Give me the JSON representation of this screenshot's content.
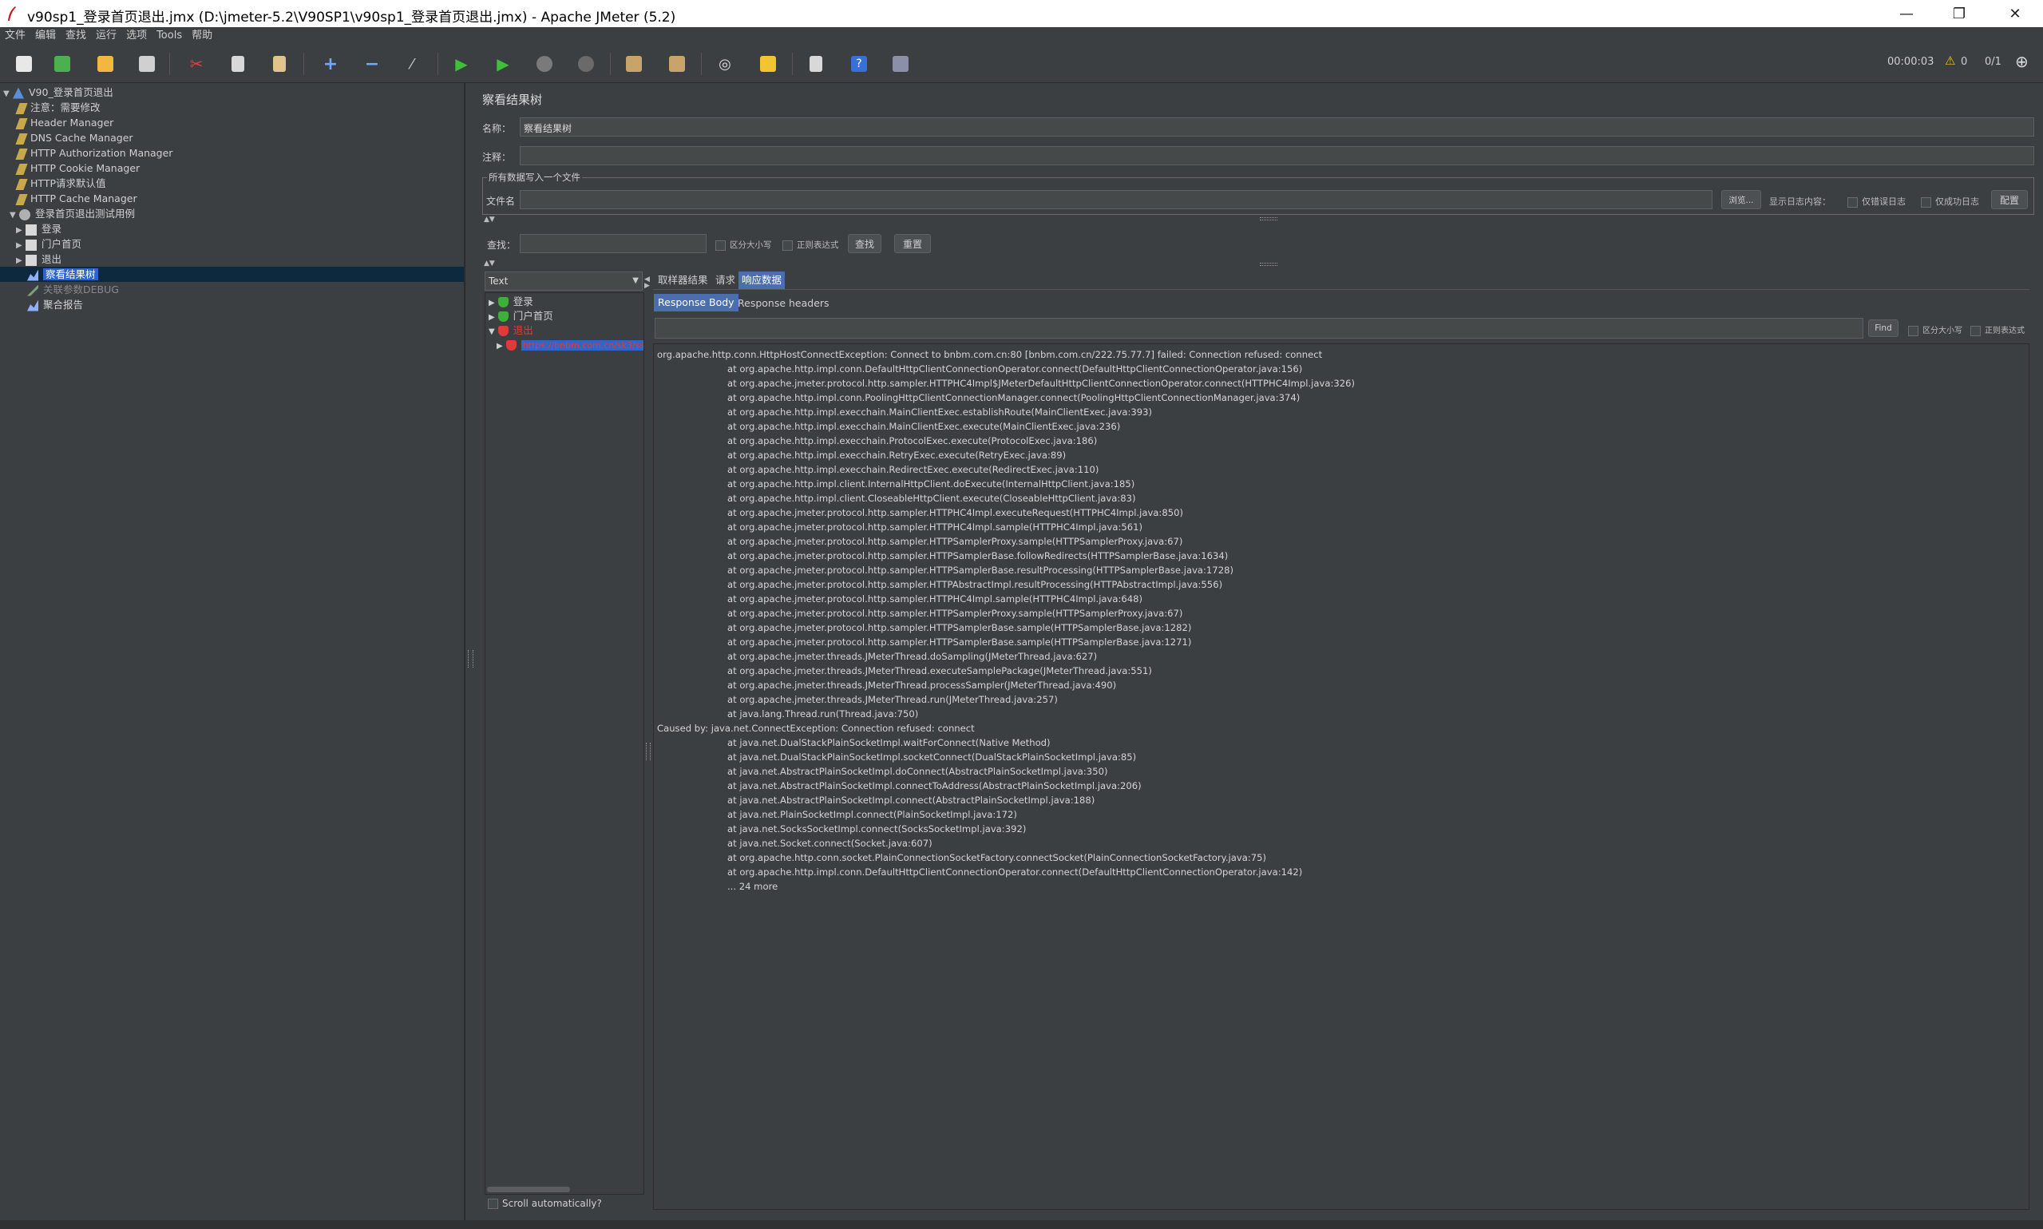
{
  "window": {
    "title": "v90sp1_登录首页退出.jmx (D:\\jmeter-5.2\\V90SP1\\v90sp1_登录首页退出.jmx) - Apache JMeter (5.2)",
    "minimize": "—",
    "maximize": "❐",
    "close": "✕"
  },
  "menu": [
    "文件",
    "编辑",
    "查找",
    "运行",
    "选项",
    "Tools",
    "帮助"
  ],
  "toolbar": {
    "elapsed": "00:00:03",
    "warnings": "0",
    "threads": "0/1"
  },
  "tree": {
    "items": [
      {
        "label": "V90_登录首页退出",
        "depth": 0,
        "expanded": true,
        "icon": "testplan-icon"
      },
      {
        "label": "注意：需要修改",
        "depth": 1,
        "icon": "config-icon"
      },
      {
        "label": "Header Manager",
        "depth": 1,
        "icon": "config-icon"
      },
      {
        "label": "DNS Cache Manager",
        "depth": 1,
        "icon": "config-icon"
      },
      {
        "label": "HTTP Authorization Manager",
        "depth": 1,
        "icon": "config-icon"
      },
      {
        "label": "HTTP Cookie Manager",
        "depth": 1,
        "icon": "config-icon"
      },
      {
        "label": "HTTP请求默认值",
        "depth": 1,
        "icon": "config-icon"
      },
      {
        "label": "HTTP Cache Manager",
        "depth": 1,
        "icon": "config-icon"
      },
      {
        "label": "登录首页退出测试用例",
        "depth": 1,
        "expanded": true,
        "icon": "threadgroup-icon"
      },
      {
        "label": "登录",
        "depth": 2,
        "collapsed": true,
        "icon": "controller-icon"
      },
      {
        "label": "门户首页",
        "depth": 2,
        "collapsed": true,
        "icon": "controller-icon"
      },
      {
        "label": "退出",
        "depth": 2,
        "collapsed": true,
        "icon": "controller-icon"
      },
      {
        "label": "察看结果树",
        "depth": 2,
        "selected": true,
        "icon": "listener-icon"
      },
      {
        "label": "关联参数DEBUG",
        "depth": 2,
        "disabled": true,
        "icon": "listener-icon"
      },
      {
        "label": "聚合报告",
        "depth": 2,
        "icon": "listener-icon"
      }
    ]
  },
  "panel": {
    "title": "察看结果树",
    "name_label": "名称：",
    "name_value": "察看结果树",
    "comment_label": "注释：",
    "comment_value": "",
    "file_group_label": "所有数据写入一个文件",
    "filename_label": "文件名",
    "filename_value": "",
    "browse_button": "浏览...",
    "log_display_label": "显示日志内容：",
    "errors_only_label": "仅错误日志",
    "success_only_label": "仅成功日志",
    "configure_button": "配置",
    "search_label": "查找：",
    "search_value": "",
    "case_sensitive_label": "区分大小写",
    "regex_label": "正则表达式",
    "find_button": "查找",
    "reset_button": "重置"
  },
  "renderer": {
    "selected": "Text"
  },
  "samples": [
    {
      "label": "登录",
      "status": "success",
      "expanded": false
    },
    {
      "label": "门户首页",
      "status": "success",
      "expanded": false
    },
    {
      "label": "退出",
      "status": "error",
      "expanded": true
    },
    {
      "label": "https://bnbm.com.cn/sk3/sso",
      "status": "error",
      "selected": true
    }
  ],
  "scroll_auto_label": "Scroll automatically?",
  "tabs": {
    "sampler_result": "取样器结果",
    "request": "请求",
    "response_data": "响应数据",
    "response_body": "Response Body",
    "response_headers": "Response headers"
  },
  "find_bar": {
    "find_button": "Find",
    "case_label": "区分大小写",
    "regex_label": "正则表达式"
  },
  "response_lines": [
    {
      "text": "org.apache.http.conn.HttpHostConnectException: Connect to bnbm.com.cn:80 [bnbm.com.cn/222.75.77.7] failed: Connection refused: connect",
      "indent": false
    },
    {
      "text": "at org.apache.http.impl.conn.DefaultHttpClientConnectionOperator.connect(DefaultHttpClientConnectionOperator.java:156)",
      "indent": true
    },
    {
      "text": "at org.apache.jmeter.protocol.http.sampler.HTTPHC4Impl$JMeterDefaultHttpClientConnectionOperator.connect(HTTPHC4Impl.java:326)",
      "indent": true
    },
    {
      "text": "at org.apache.http.impl.conn.PoolingHttpClientConnectionManager.connect(PoolingHttpClientConnectionManager.java:374)",
      "indent": true
    },
    {
      "text": "at org.apache.http.impl.execchain.MainClientExec.establishRoute(MainClientExec.java:393)",
      "indent": true
    },
    {
      "text": "at org.apache.http.impl.execchain.MainClientExec.execute(MainClientExec.java:236)",
      "indent": true
    },
    {
      "text": "at org.apache.http.impl.execchain.ProtocolExec.execute(ProtocolExec.java:186)",
      "indent": true
    },
    {
      "text": "at org.apache.http.impl.execchain.RetryExec.execute(RetryExec.java:89)",
      "indent": true
    },
    {
      "text": "at org.apache.http.impl.execchain.RedirectExec.execute(RedirectExec.java:110)",
      "indent": true
    },
    {
      "text": "at org.apache.http.impl.client.InternalHttpClient.doExecute(InternalHttpClient.java:185)",
      "indent": true
    },
    {
      "text": "at org.apache.http.impl.client.CloseableHttpClient.execute(CloseableHttpClient.java:83)",
      "indent": true
    },
    {
      "text": "at org.apache.jmeter.protocol.http.sampler.HTTPHC4Impl.executeRequest(HTTPHC4Impl.java:850)",
      "indent": true
    },
    {
      "text": "at org.apache.jmeter.protocol.http.sampler.HTTPHC4Impl.sample(HTTPHC4Impl.java:561)",
      "indent": true
    },
    {
      "text": "at org.apache.jmeter.protocol.http.sampler.HTTPSamplerProxy.sample(HTTPSamplerProxy.java:67)",
      "indent": true
    },
    {
      "text": "at org.apache.jmeter.protocol.http.sampler.HTTPSamplerBase.followRedirects(HTTPSamplerBase.java:1634)",
      "indent": true
    },
    {
      "text": "at org.apache.jmeter.protocol.http.sampler.HTTPSamplerBase.resultProcessing(HTTPSamplerBase.java:1728)",
      "indent": true
    },
    {
      "text": "at org.apache.jmeter.protocol.http.sampler.HTTPAbstractImpl.resultProcessing(HTTPAbstractImpl.java:556)",
      "indent": true
    },
    {
      "text": "at org.apache.jmeter.protocol.http.sampler.HTTPHC4Impl.sample(HTTPHC4Impl.java:648)",
      "indent": true
    },
    {
      "text": "at org.apache.jmeter.protocol.http.sampler.HTTPSamplerProxy.sample(HTTPSamplerProxy.java:67)",
      "indent": true
    },
    {
      "text": "at org.apache.jmeter.protocol.http.sampler.HTTPSamplerBase.sample(HTTPSamplerBase.java:1282)",
      "indent": true
    },
    {
      "text": "at org.apache.jmeter.protocol.http.sampler.HTTPSamplerBase.sample(HTTPSamplerBase.java:1271)",
      "indent": true
    },
    {
      "text": "at org.apache.jmeter.threads.JMeterThread.doSampling(JMeterThread.java:627)",
      "indent": true
    },
    {
      "text": "at org.apache.jmeter.threads.JMeterThread.executeSamplePackage(JMeterThread.java:551)",
      "indent": true
    },
    {
      "text": "at org.apache.jmeter.threads.JMeterThread.processSampler(JMeterThread.java:490)",
      "indent": true
    },
    {
      "text": "at org.apache.jmeter.threads.JMeterThread.run(JMeterThread.java:257)",
      "indent": true
    },
    {
      "text": "at java.lang.Thread.run(Thread.java:750)",
      "indent": true
    },
    {
      "text": "Caused by: java.net.ConnectException: Connection refused: connect",
      "indent": false
    },
    {
      "text": "at java.net.DualStackPlainSocketImpl.waitForConnect(Native Method)",
      "indent": true
    },
    {
      "text": "at java.net.DualStackPlainSocketImpl.socketConnect(DualStackPlainSocketImpl.java:85)",
      "indent": true
    },
    {
      "text": "at java.net.AbstractPlainSocketImpl.doConnect(AbstractPlainSocketImpl.java:350)",
      "indent": true
    },
    {
      "text": "at java.net.AbstractPlainSocketImpl.connectToAddress(AbstractPlainSocketImpl.java:206)",
      "indent": true
    },
    {
      "text": "at java.net.AbstractPlainSocketImpl.connect(AbstractPlainSocketImpl.java:188)",
      "indent": true
    },
    {
      "text": "at java.net.PlainSocketImpl.connect(PlainSocketImpl.java:172)",
      "indent": true
    },
    {
      "text": "at java.net.SocksSocketImpl.connect(SocksSocketImpl.java:392)",
      "indent": true
    },
    {
      "text": "at java.net.Socket.connect(Socket.java:607)",
      "indent": true
    },
    {
      "text": "at org.apache.http.conn.socket.PlainConnectionSocketFactory.connectSocket(PlainConnectionSocketFactory.java:75)",
      "indent": true
    },
    {
      "text": "at org.apache.http.impl.conn.DefaultHttpClientConnectionOperator.connect(DefaultHttpClientConnectionOperator.java:142)",
      "indent": true
    },
    {
      "text": "... 24 more",
      "indent": true
    }
  ],
  "colors": {
    "background": "#3c3f41",
    "selection": "#2f65ca",
    "active_tab": "#4b6eaf",
    "error": "#e03b3b",
    "success": "#3fae3a"
  }
}
